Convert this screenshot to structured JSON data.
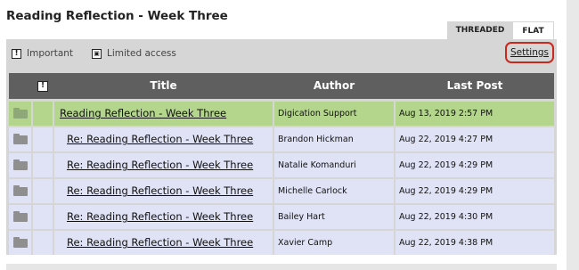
{
  "page": {
    "title": "Reading Reflection - Week Three"
  },
  "view_tabs": {
    "threaded": "THREADED",
    "flat": "FLAT"
  },
  "legend": {
    "important_icon_glyph": "!",
    "important": "Important",
    "limited_icon_glyph": "▣",
    "limited": "Limited access",
    "settings": "Settings"
  },
  "table": {
    "headers": {
      "important_icon_glyph": "!",
      "title": "Title",
      "author": "Author",
      "last_post": "Last Post"
    },
    "rows": [
      {
        "title": "Reading Reflection - Week Three",
        "author": "Digication Support",
        "last_post": "Aug 13, 2019 2:57 PM"
      },
      {
        "title": "Re: Reading Reflection - Week Three",
        "author": "Brandon Hickman",
        "last_post": "Aug 22, 2019 4:27 PM"
      },
      {
        "title": "Re: Reading Reflection - Week Three",
        "author": "Natalie Komanduri",
        "last_post": "Aug 22, 2019 4:29 PM"
      },
      {
        "title": "Re: Reading Reflection - Week Three",
        "author": "Michelle Carlock",
        "last_post": "Aug 22, 2019 4:29 PM"
      },
      {
        "title": "Re: Reading Reflection - Week Three",
        "author": "Bailey Hart",
        "last_post": "Aug 22, 2019 4:30 PM"
      },
      {
        "title": "Re: Reading Reflection - Week Three",
        "author": "Xavier Camp",
        "last_post": "Aug 22, 2019 4:38 PM"
      }
    ]
  },
  "colors": {
    "first_row": "#b3d58c",
    "reply_row": "#dfe3f5",
    "header_bg": "#5f5f5f",
    "settings_highlight": "#c8281e"
  },
  "icons": {
    "folder": "folder-icon",
    "important": "exclamation-box-icon",
    "limited": "lock-box-icon"
  }
}
